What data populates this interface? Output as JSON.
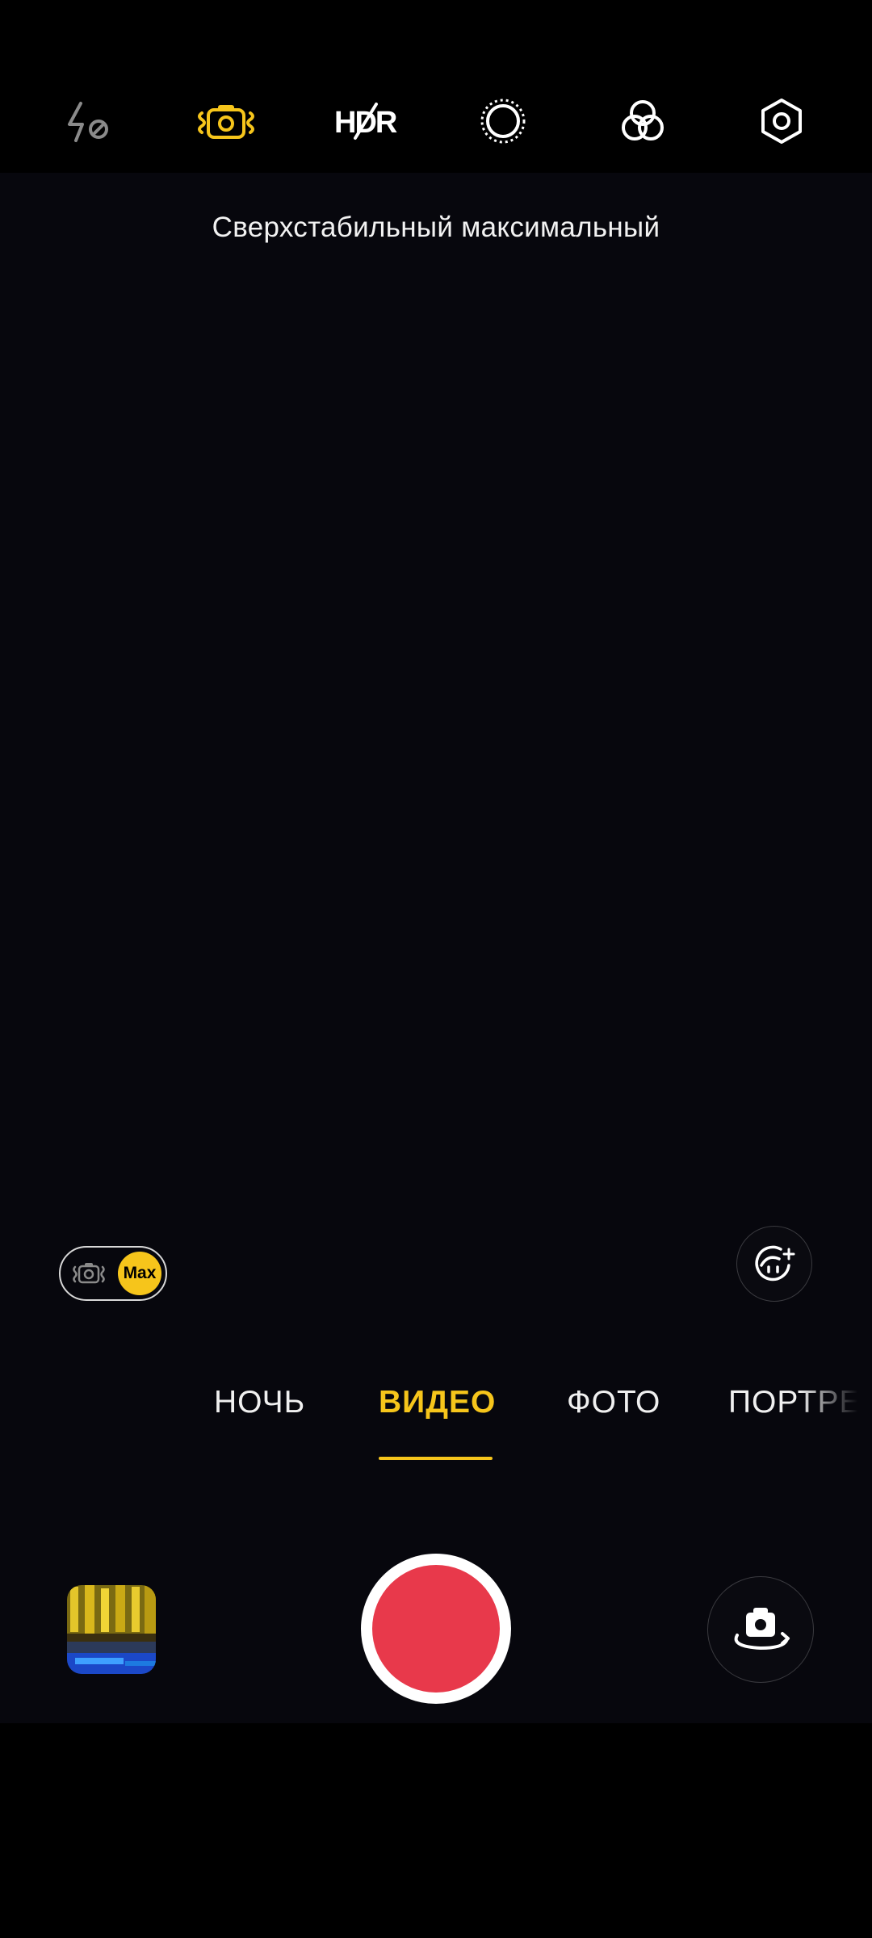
{
  "top_bar": {
    "icons": [
      "flash-off-icon",
      "stabilization-icon",
      "hdr-off-icon",
      "filter-ring-icon",
      "color-filter-icon",
      "settings-icon"
    ],
    "hdr_label": "HDR",
    "accent_color": "#f6c51b"
  },
  "viewfinder": {
    "stabilization_text": "Сверхстабильный максимальный"
  },
  "stabilization_toggle": {
    "badge": "Max"
  },
  "modes": {
    "items": [
      "НОЧЬ",
      "ВИДЕО",
      "ФОТО",
      "ПОРТРЕТ"
    ],
    "selected": "ВИДЕО"
  },
  "bottom_bar": {
    "shutter_color": "#e8394b"
  }
}
